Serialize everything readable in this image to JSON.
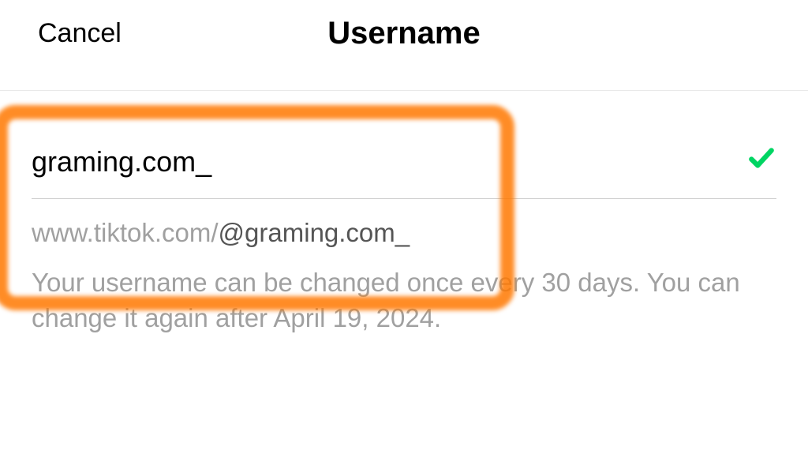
{
  "header": {
    "cancel_label": "Cancel",
    "title": "Username"
  },
  "form": {
    "username_value": "graming.com_",
    "url_prefix": "www.tiktok.com/",
    "url_handle": "@graming.com_",
    "info_text": "Your username can be changed once every 30 days. You can change it again after April 19, 2024."
  }
}
